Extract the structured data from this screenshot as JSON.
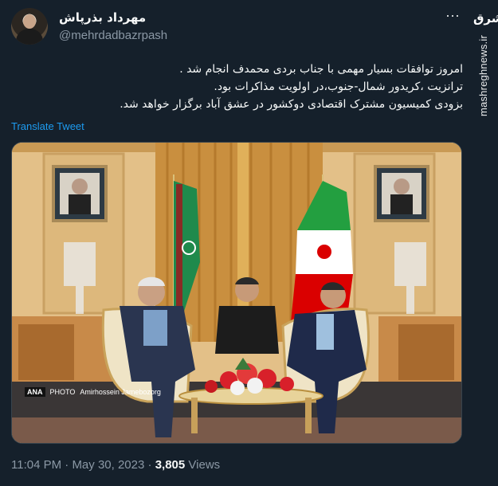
{
  "author": {
    "display_name": "مهرداد بذرپاش",
    "handle": "@mehrdadbazrpash"
  },
  "more_label": "···",
  "watermark": {
    "logo_text": "مشرق",
    "site": "mashreghnews.ir"
  },
  "tweet": {
    "lines": [
      "امروز توافقات بسیار مهمی با جناب بردی محمدف انجام شد .",
      "ترانزیت ،کریدور شمال-جنوب،در اولویت مذاکرات بود.",
      "بزودی کمیسیون مشترک اقتصادی دوکشور در عشق آباد برگزار خواهد شد."
    ],
    "translate_label": "Translate Tweet"
  },
  "photo": {
    "credit_badge": "ANA",
    "credit_badge_sub": "PHOTO",
    "credit_name": "Amirhossein Jamebozorg"
  },
  "meta": {
    "time": "11:04 PM",
    "separator": "·",
    "date": "May 30, 2023",
    "views_count": "3,805",
    "views_label": "Views"
  },
  "colors": {
    "background": "#15202b",
    "link": "#1d9bf0",
    "secondary_text": "#8b98a5"
  }
}
